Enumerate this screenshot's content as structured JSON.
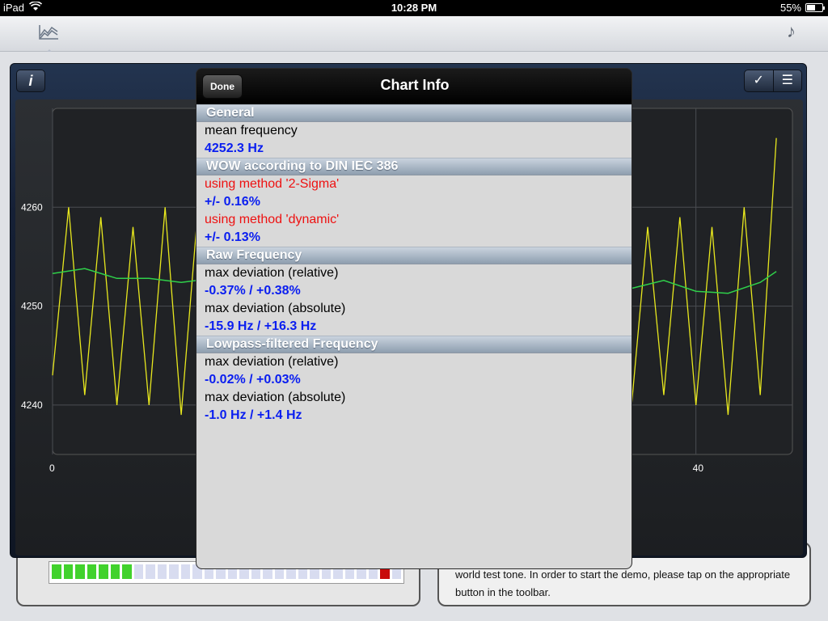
{
  "status_bar": {
    "device": "iPad",
    "time": "10:28 PM",
    "battery": "55%",
    "battery_level": 0.55
  },
  "toolbar": {
    "left_icon": "line-chart-icon",
    "right_icon": "music-note-icon"
  },
  "chart_panel": {
    "info_icon": "info-icon",
    "check_icon": "checkmark-icon",
    "list_icon": "list-icon"
  },
  "chart_data": {
    "type": "line",
    "ylim": [
      4235,
      4270
    ],
    "xlim": [
      0,
      46
    ],
    "y_ticks": [
      "4260",
      "4250",
      "4240"
    ],
    "x_ticks": [
      "0",
      "40"
    ],
    "grid": true,
    "series": [
      {
        "color": "#e8e81e",
        "x": [
          0,
          1,
          2,
          3,
          4,
          5,
          6,
          7,
          8,
          9,
          10,
          34,
          35,
          36,
          37,
          38,
          39,
          40,
          41,
          42,
          43,
          44,
          45
        ],
        "values": [
          4243,
          4260,
          4241,
          4259,
          4240,
          4258,
          4240,
          4260,
          4239,
          4259,
          4238,
          4241,
          4259,
          4240,
          4258,
          4241,
          4259,
          4240,
          4258,
          4239,
          4260,
          4241,
          4267
        ]
      },
      {
        "color": "#2fd04a",
        "x": [
          0,
          2,
          4,
          6,
          8,
          10,
          34,
          36,
          38,
          40,
          42,
          44,
          45
        ],
        "values": [
          4253.3,
          4253.8,
          4252.8,
          4252.8,
          4252.4,
          4252.8,
          4251.3,
          4251.8,
          4252.6,
          4251.5,
          4251.3,
          4252.4,
          4253.5
        ]
      }
    ]
  },
  "popover": {
    "title": "Chart Info",
    "done_label": "Done",
    "sections": [
      {
        "header": "General",
        "rows": [
          {
            "text": "mean frequency",
            "kind": "label"
          },
          {
            "text": "4252.3 Hz",
            "kind": "value"
          }
        ]
      },
      {
        "header": "WOW according to DIN IEC 386",
        "rows": [
          {
            "text": "using method '2-Sigma'",
            "kind": "method"
          },
          {
            "text": "+/- 0.16%",
            "kind": "value"
          },
          {
            "text": "using method 'dynamic'",
            "kind": "method"
          },
          {
            "text": "+/- 0.13%",
            "kind": "value"
          }
        ]
      },
      {
        "header": "Raw Frequency",
        "rows": [
          {
            "text": "max deviation (relative)",
            "kind": "label"
          },
          {
            "text": "-0.37% / +0.38%",
            "kind": "value"
          },
          {
            "text": "max deviation (absolute)",
            "kind": "label"
          },
          {
            "text": "-15.9 Hz / +16.3 Hz",
            "kind": "value"
          }
        ]
      },
      {
        "header": "Lowpass-filtered Frequency",
        "rows": [
          {
            "text": "max deviation (relative)",
            "kind": "label"
          },
          {
            "text": "-0.02% / +0.03%",
            "kind": "value"
          },
          {
            "text": "max deviation (absolute)",
            "kind": "label"
          },
          {
            "text": "-1.0 Hz / +1.4 Hz",
            "kind": "value"
          }
        ]
      }
    ]
  },
  "demo_panel": {
    "text": "world test tone. In order to start the demo, please tap on the appropriate button in the toolbar."
  },
  "level_meter": {
    "active_segments": 7,
    "total_segments": 30,
    "peak_segment": 29
  }
}
